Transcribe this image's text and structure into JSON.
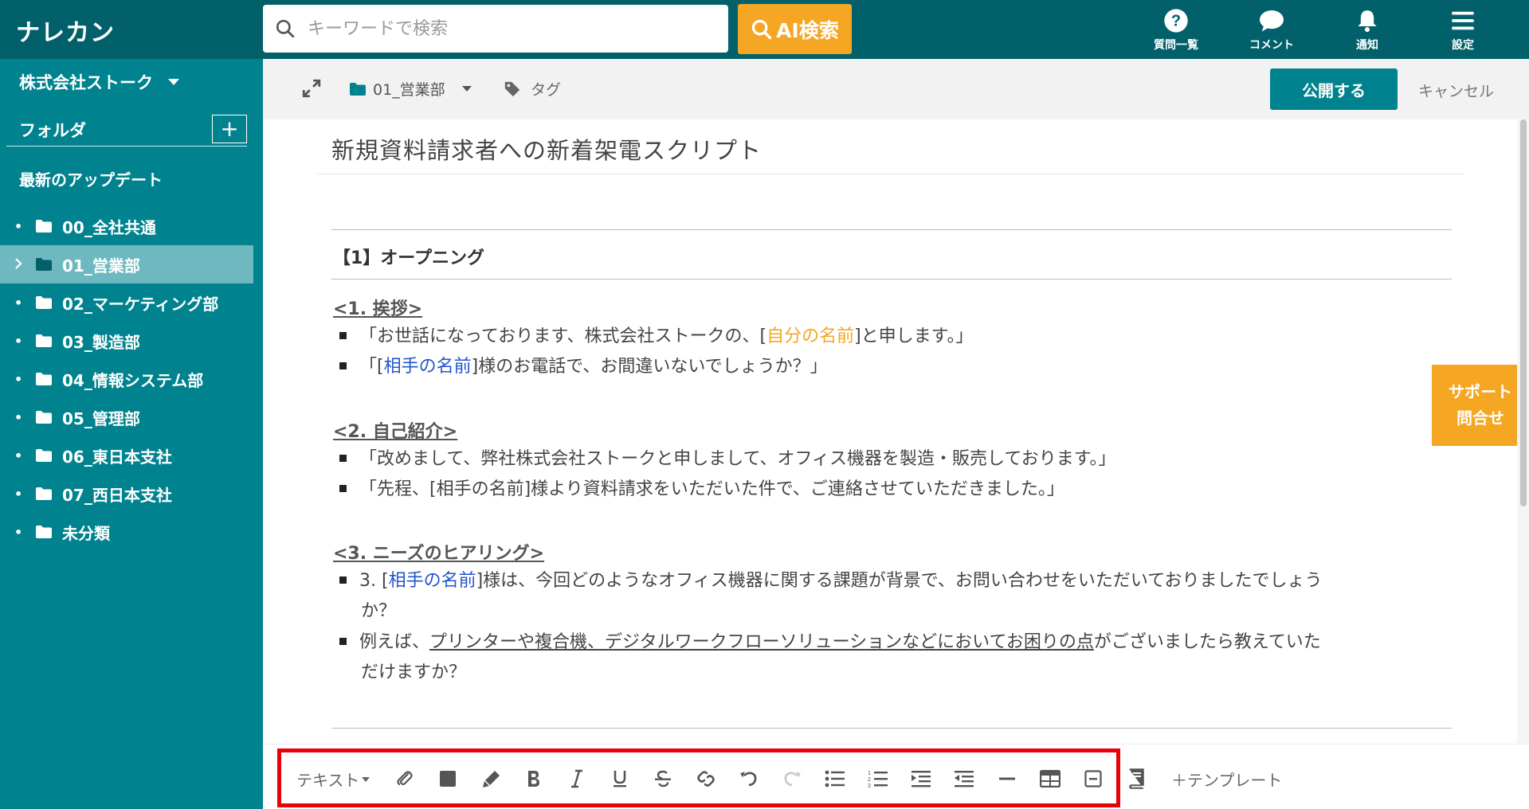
{
  "app": {
    "logo": "ナレカン"
  },
  "search": {
    "placeholder": "キーワードで検索",
    "ai_button": "AI検索"
  },
  "top_nav": [
    {
      "label": "質問一覧",
      "icon": "question-circle-icon"
    },
    {
      "label": "コメント",
      "icon": "speech-bubble-icon"
    },
    {
      "label": "通知",
      "icon": "bell-icon"
    },
    {
      "label": "設定",
      "icon": "hamburger-menu-icon"
    }
  ],
  "sidebar": {
    "company": "株式会社ストーク",
    "folder_header": "フォルダ",
    "add_label": "+",
    "updates": "最新のアップデート",
    "folders": [
      {
        "label": "00_全社共通",
        "active": false
      },
      {
        "label": "01_営業部",
        "active": true
      },
      {
        "label": "02_マーケティング部",
        "active": false
      },
      {
        "label": "03_製造部",
        "active": false
      },
      {
        "label": "04_情報システム部",
        "active": false
      },
      {
        "label": "05_管理部",
        "active": false
      },
      {
        "label": "06_東日本支社",
        "active": false
      },
      {
        "label": "07_西日本支社",
        "active": false
      },
      {
        "label": "未分類",
        "active": false
      }
    ]
  },
  "editor_header": {
    "folder": "01_営業部",
    "tag": "タグ",
    "publish": "公開する",
    "cancel": "キャンセル"
  },
  "document": {
    "title": "新規資料請求者への新着架電スクリプト",
    "section_title": "【1】オープニング",
    "subsections": [
      {
        "heading": "<1. 挨拶>",
        "lines": [
          {
            "a": "「お世話になっております、株式会社ストークの、[",
            "b": "自分の名前",
            "c": "]と申します。」"
          },
          {
            "a": "「[",
            "b": "相手の名前",
            "c": "]様のお電話で、お間違いないでしょうか？」"
          }
        ]
      },
      {
        "heading": "<2. 自己紹介>",
        "lines": [
          {
            "text": "「改めまして、弊社株式会社ストークと申しまして、オフィス機器を製造・販売しております。」"
          },
          {
            "text": "「先程、[相手の名前]様より資料請求をいただいた件で、ご連絡させていただきました。」"
          }
        ]
      },
      {
        "heading": "<3. ニーズのヒアリング>",
        "lines": [
          {
            "a": "3. [",
            "b": "相手の名前",
            "c": "]様は、今回どのようなオフィス機器に関する課題が背景で、お問い合わせをいただいておりましたでしょう",
            "d": "か？"
          },
          {
            "a": "例えば、",
            "b": "プリンターや複合機、デジタルワークフローソリューションなどにおいてお困りの点",
            "c": "がございましたら教えていた",
            "d": "だけますか？"
          }
        ]
      }
    ]
  },
  "support": {
    "line1": "サポート",
    "line2": "問合せ"
  },
  "toolbar": {
    "text_style": "テキスト",
    "template": "＋テンプレート",
    "icons": [
      "paperclip-icon",
      "text-color-icon",
      "highlighter-icon",
      "bold-icon",
      "italic-icon",
      "underline-icon",
      "strikethrough-icon",
      "link-icon",
      "undo-icon",
      "redo-icon",
      "bullet-list-icon",
      "numbered-list-icon",
      "indent-icon",
      "outdent-icon",
      "horizontal-rule-icon",
      "table-icon",
      "collapse-block-icon",
      "book-icon"
    ]
  },
  "colors": {
    "header": "#01606a",
    "sidebar": "#00838f",
    "accent": "#f5a623",
    "highlight_box": "#e8000b"
  }
}
